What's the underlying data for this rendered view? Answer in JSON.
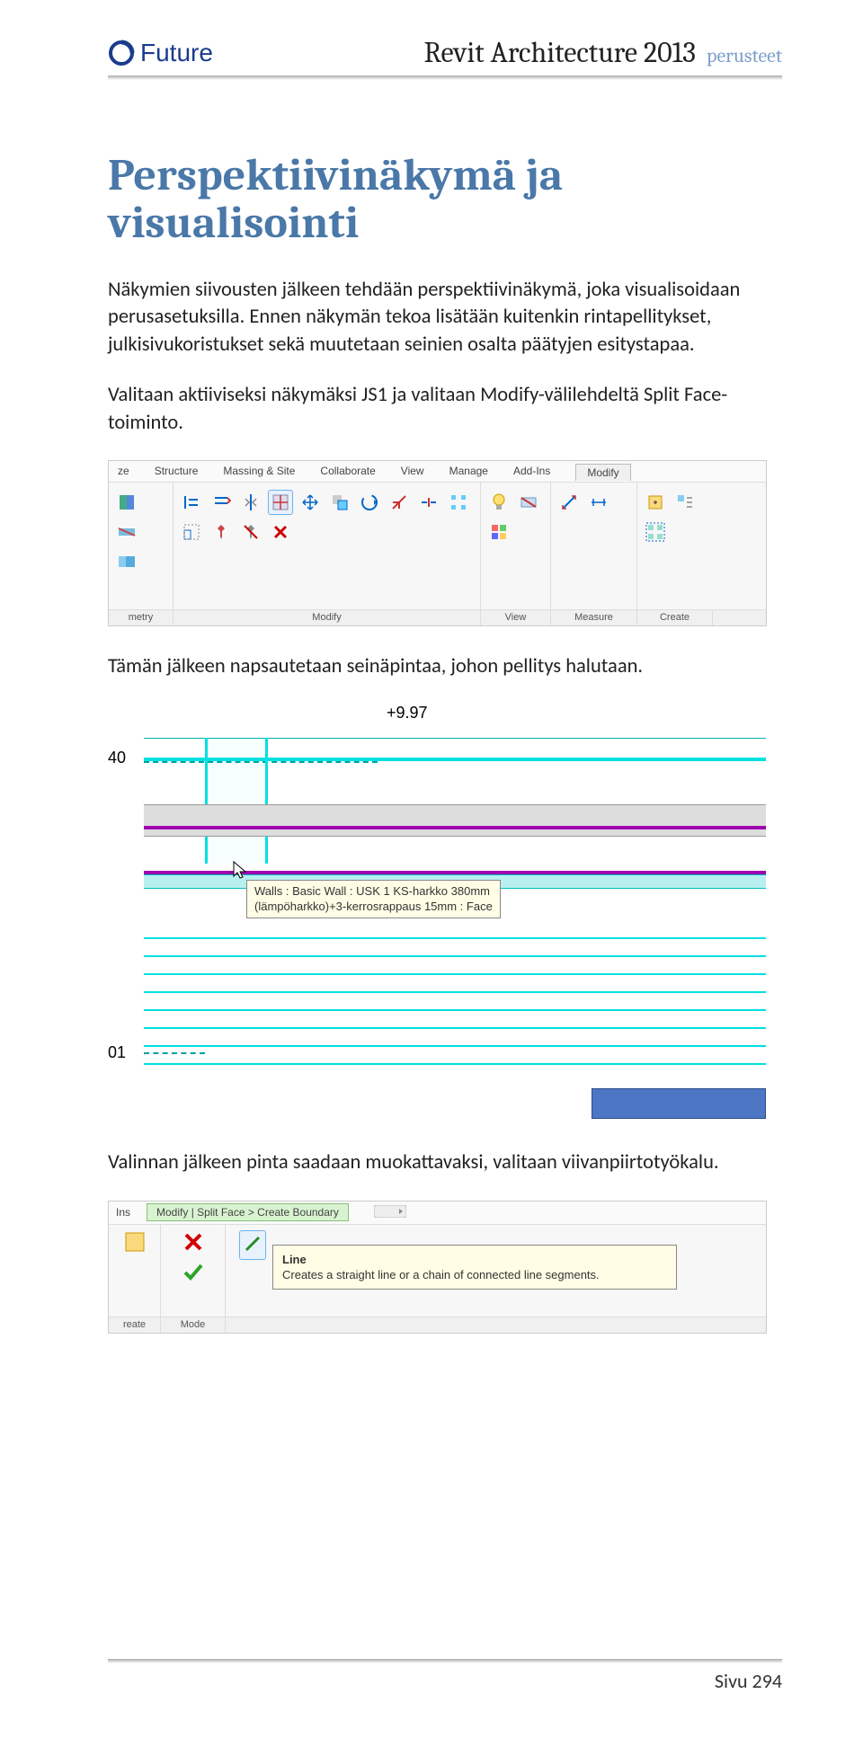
{
  "header": {
    "logo_text": "Future",
    "title": "Revit Architecture 2013",
    "subtitle": "perusteet"
  },
  "h1": "Perspektiivinäkymä ja visualisointi",
  "para1": "Näkymien siivousten jälkeen tehdään perspektiivinäkymä, joka visualisoidaan perusasetuksilla. Ennen näkymän tekoa lisätään kuitenkin rintapellitykset, julkisivukoristukset sekä muutetaan seinien osalta päätyjen esitystapaa.",
  "para2": "Valitaan aktiiviseksi näkymäksi JS1 ja valitaan Modify-välilehdeltä Split Face-toiminto.",
  "ribbon1": {
    "tabs": [
      "ze",
      "Structure",
      "Massing & Site",
      "Collaborate",
      "View",
      "Manage",
      "Add-Ins",
      "Modify"
    ],
    "panels": [
      "metry",
      "Modify",
      "View",
      "Measure",
      "Create"
    ]
  },
  "sectionview": {
    "label_top": "+9.97",
    "label_left_upper": "40",
    "label_left_lower": "01",
    "tooltip_line1": "Walls : Basic Wall : USK 1 KS-harkko 380mm",
    "tooltip_line2": "(lämpöharkko)+3-kerrosrappaus 15mm : Face"
  },
  "para3": "Tämän jälkeen napsautetaan seinäpintaa, johon pellitys halutaan.",
  "para4": "Valinnan jälkeen pinta saadaan muokattavaksi, valitaan viivanpiirtotyökalu.",
  "ribbon2": {
    "tabs": [
      "Ins",
      "Modify | Split Face > Create Boundary"
    ],
    "panels": [
      "reate",
      "Mode"
    ],
    "tooltip_title": "Line",
    "tooltip_body": "Creates a straight line or a chain of connected line segments."
  },
  "footer": {
    "page": "Sivu 294"
  }
}
